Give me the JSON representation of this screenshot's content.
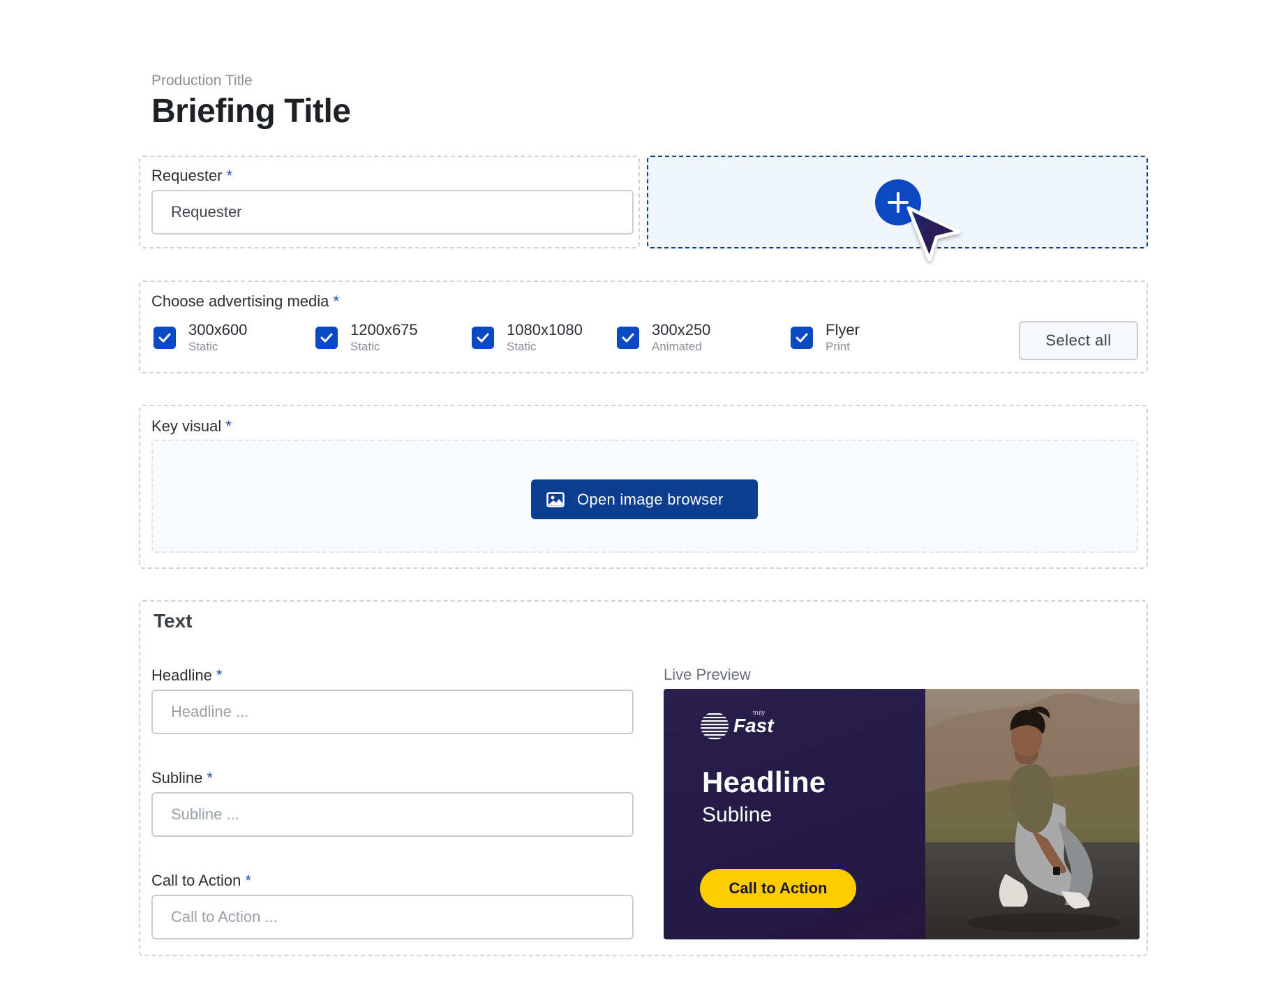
{
  "header": {
    "subtitle": "Production Title",
    "title": "Briefing Title"
  },
  "requester": {
    "label": "Requester",
    "required": "*",
    "value": "",
    "placeholder": "Requester"
  },
  "media": {
    "label": "Choose advertising media",
    "required": "*",
    "options": [
      {
        "label": "300x600",
        "sub": "Static",
        "checked": true
      },
      {
        "label": "1200x675",
        "sub": "Static",
        "checked": true
      },
      {
        "label": "1080x1080",
        "sub": "Static",
        "checked": true
      },
      {
        "label": "300x250",
        "sub": "Animated",
        "checked": true
      },
      {
        "label": "Flyer",
        "sub": "Print",
        "checked": true
      }
    ],
    "select_all_label": "Select all"
  },
  "key_visual": {
    "label": "Key visual",
    "required": "*",
    "button_label": "Open image browser"
  },
  "text_section": {
    "heading": "Text",
    "headline": {
      "label": "Headline",
      "required": "*",
      "placeholder": "Headline ..."
    },
    "subline": {
      "label": "Subline",
      "required": "*",
      "placeholder": "Subline ..."
    },
    "cta": {
      "label": "Call to Action",
      "required": "*",
      "placeholder": "Call to Action ..."
    }
  },
  "preview": {
    "label": "Live Preview",
    "brand_small": "truly",
    "brand": "Fast",
    "headline": "Headline",
    "subline": "Subline",
    "cta": "Call to Action"
  },
  "colors": {
    "accent": "#0a48c4",
    "button_dark": "#0c3d8e",
    "cta_yellow": "#ffcc00",
    "ad_background": "#241b47"
  },
  "icons": {
    "add": "plus-icon",
    "cursor": "cursor-arrow-icon",
    "check": "checkmark-icon",
    "image": "image-icon",
    "logo": "striped-globe-icon"
  }
}
